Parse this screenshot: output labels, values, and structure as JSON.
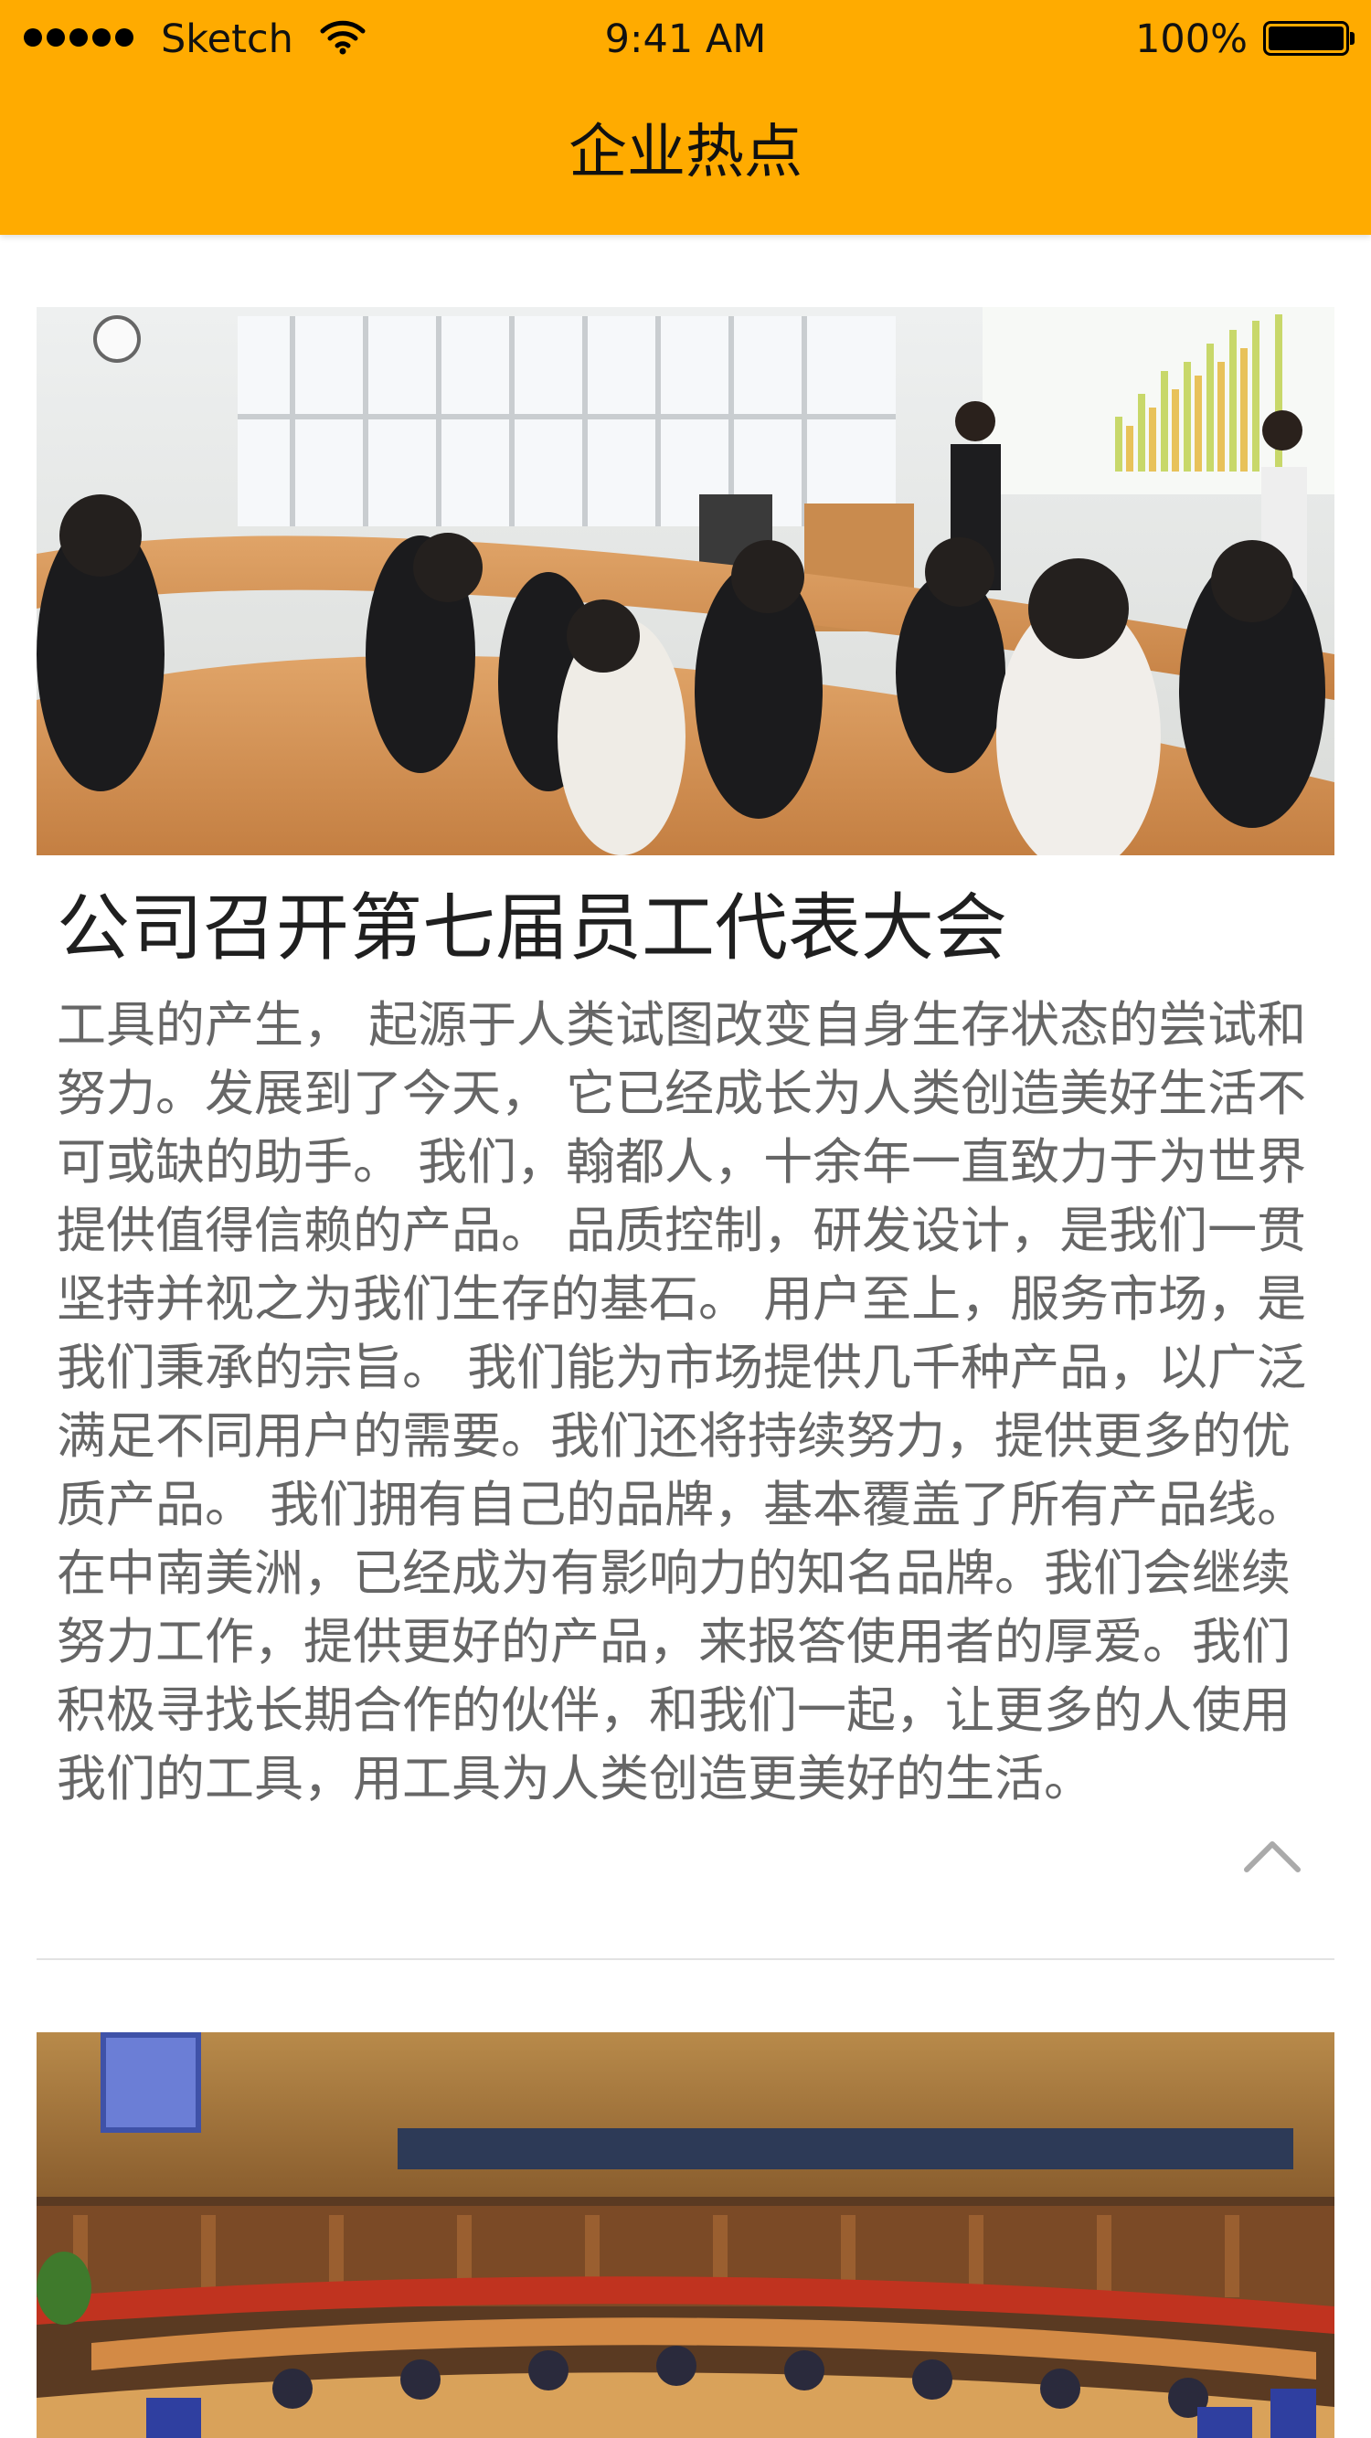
{
  "status_bar": {
    "carrier": "Sketch",
    "time": "9:41 AM",
    "battery": "100%"
  },
  "header": {
    "title": "企业热点"
  },
  "articles": [
    {
      "title": "公司召开第七届员工代表大会",
      "body": "工具的产生， 起源于人类试图改变自身生存状态的尝试和努力。发展到了今天， 它已经成长为人类创造美好生活不可或缺的助手。 我们，翰都人，十余年一直致力于为世界提供值得信赖的产品。 品质控制，研发设计，是我们一贯坚持并视之为我们生存的基石。 用户至上，服务市场，是我们秉承的宗旨。 我们能为市场提供几千种产品，以广泛满足不同用户的需要。我们还将持续努力，提供更多的优质产品。 我们拥有自己的品牌，基本覆盖了所有产品线。在中南美洲，已经成为有影响力的知名品牌。我们会继续努力工作，提供更好的产品，来报答使用者的厚爱。我们积极寻找长期合作的伙伴，和我们一起，让更多的人使用我们的工具，用工具为人类创造更美好的生活。"
    }
  ],
  "icons": {
    "signal": "signal-dots-icon",
    "wifi": "wifi-icon",
    "battery": "battery-icon",
    "collapse": "chevron-up-icon"
  },
  "colors": {
    "header_bg": "#FFAB00",
    "title_text": "#1F1F1F",
    "body_text": "#666666",
    "divider": "#E2E2E2"
  }
}
